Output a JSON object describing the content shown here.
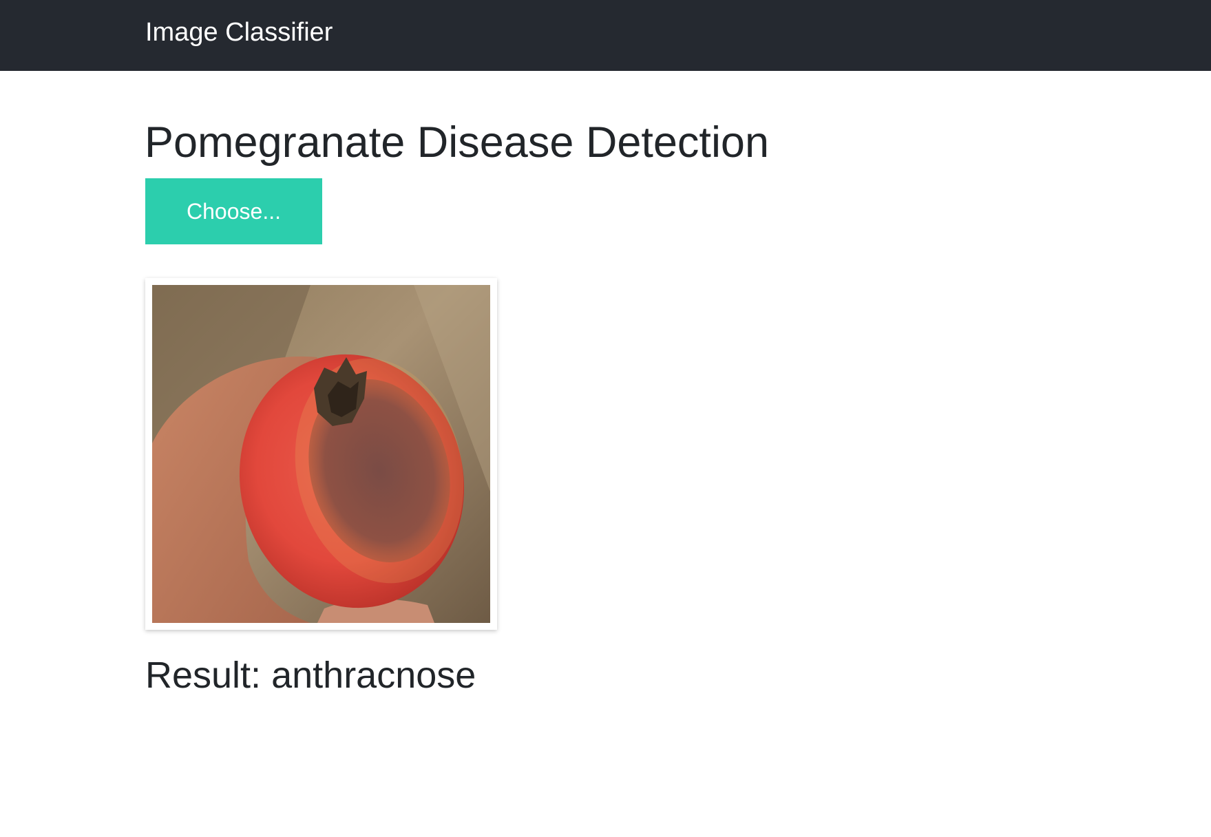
{
  "navbar": {
    "brand": "Image Classifier",
    "background_color": "#252930"
  },
  "main": {
    "title": "Pomegranate Disease Detection",
    "upload": {
      "label": "Choose...",
      "color": "#2ccead"
    },
    "preview_image": {
      "subject": "pomegranate-with-anthracnose-lesion"
    },
    "result": {
      "prefix": "Result:",
      "value": "anthracnose"
    }
  }
}
